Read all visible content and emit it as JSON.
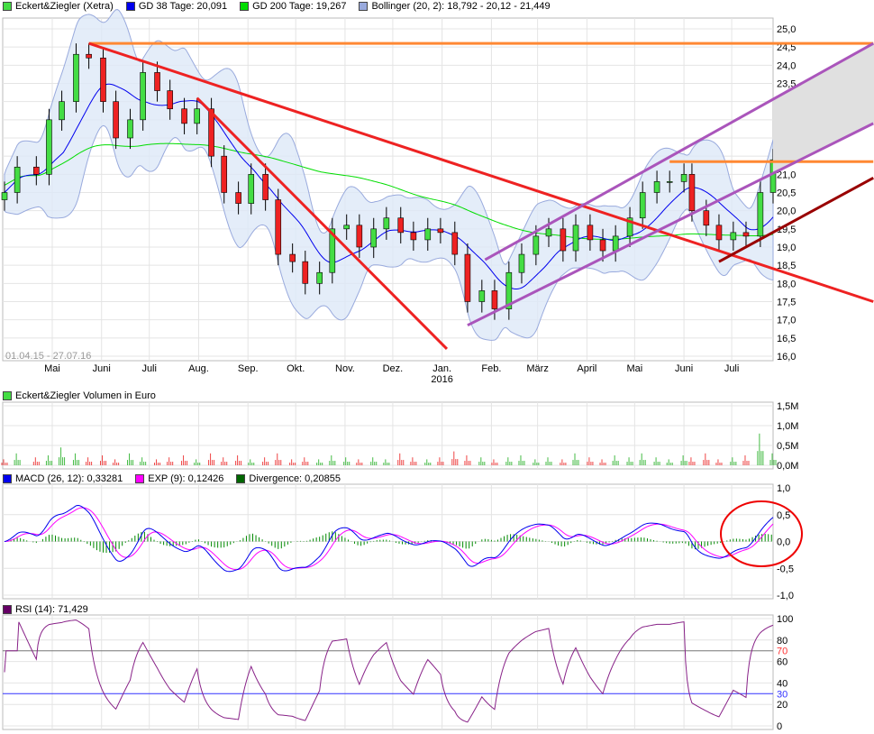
{
  "legends": {
    "price": [
      {
        "label": "Eckert&Ziegler (Xetra)",
        "color": "#44dd44"
      },
      {
        "label": "GD 38 Tage: 20,091",
        "color": "#0000ee"
      },
      {
        "label": "GD 200 Tage: 19,267",
        "color": "#00dd00"
      },
      {
        "label": "Bollinger (20, 2): 18,792 - 20,12 - 21,449",
        "color": "#99aadd"
      }
    ],
    "volume": [
      {
        "label": "Eckert&Ziegler Volumen in Euro",
        "color": "#44dd44"
      }
    ],
    "macd": [
      {
        "label": "MACD (26, 12): 0,33281",
        "color": "#0000ee"
      },
      {
        "label": "EXP (9): 0,12426",
        "color": "#ff00ff"
      },
      {
        "label": "Divergence: 0,20855",
        "color": "#006600"
      }
    ],
    "rsi": [
      {
        "label": "RSI (14): 71,429",
        "color": "#660066"
      }
    ]
  },
  "date_range": "01.04.15 - 27.07.16",
  "chart_data": [
    {
      "type": "candlestick",
      "panel": "price",
      "ylim": [
        16.0,
        25.0
      ],
      "yticks": [
        "16,0",
        "16,5",
        "17,0",
        "17,5",
        "18,0",
        "18,5",
        "19,0",
        "19,5",
        "20,0",
        "20,5",
        "21,0",
        "21,5",
        "22,0",
        "22,5",
        "23,0",
        "23,5",
        "24,0",
        "24,5",
        "25,0"
      ],
      "xticks": [
        {
          "label": "Mai",
          "date": "2015-05-01"
        },
        {
          "label": "Juni",
          "date": "2015-06-01"
        },
        {
          "label": "Juli",
          "date": "2015-07-01"
        },
        {
          "label": "Aug.",
          "date": "2015-08-01"
        },
        {
          "label": "Sep.",
          "date": "2015-09-01"
        },
        {
          "label": "Okt.",
          "date": "2015-10-01"
        },
        {
          "label": "Nov.",
          "date": "2015-11-01"
        },
        {
          "label": "Dez.",
          "date": "2015-12-01"
        },
        {
          "label": "Jan.",
          "date": "2016-01-01",
          "sub": "2016"
        },
        {
          "label": "Feb.",
          "date": "2016-02-01"
        },
        {
          "label": "März",
          "date": "2016-03-01"
        },
        {
          "label": "April",
          "date": "2016-04-01"
        },
        {
          "label": "Mai",
          "date": "2016-05-01"
        },
        {
          "label": "Juni",
          "date": "2016-06-01"
        },
        {
          "label": "Juli",
          "date": "2016-07-01"
        }
      ],
      "dates": [
        "2015-04-01",
        "2015-04-09",
        "2015-04-21",
        "2015-04-29",
        "2015-05-07",
        "2015-05-16",
        "2015-05-24",
        "2015-06-02",
        "2015-06-10",
        "2015-06-19",
        "2015-06-27",
        "2015-07-06",
        "2015-07-14",
        "2015-07-23",
        "2015-07-31",
        "2015-08-09",
        "2015-08-17",
        "2015-08-26",
        "2015-09-03",
        "2015-09-12",
        "2015-09-20",
        "2015-09-29",
        "2015-10-07",
        "2015-10-16",
        "2015-10-24",
        "2015-11-02",
        "2015-11-10",
        "2015-11-19",
        "2015-11-27",
        "2015-12-06",
        "2015-12-14",
        "2015-12-23",
        "2015-12-31",
        "2016-01-09",
        "2016-01-17",
        "2016-01-26",
        "2016-02-03",
        "2016-02-12",
        "2016-02-20",
        "2016-02-29",
        "2016-03-08",
        "2016-03-17",
        "2016-03-25",
        "2016-04-03",
        "2016-04-11",
        "2016-04-19",
        "2016-04-28",
        "2016-05-06",
        "2016-05-15",
        "2016-05-23",
        "2016-06-01",
        "2016-06-06",
        "2016-06-15",
        "2016-06-23",
        "2016-07-02",
        "2016-07-10",
        "2016-07-19",
        "2016-07-27"
      ],
      "close": [
        20.5,
        21.2,
        21.0,
        22.5,
        23.0,
        24.3,
        24.2,
        23.0,
        22.0,
        22.5,
        23.8,
        23.3,
        22.8,
        22.4,
        22.8,
        21.5,
        20.5,
        20.2,
        21.0,
        20.3,
        18.8,
        18.6,
        18.0,
        18.3,
        19.5,
        19.6,
        19.0,
        19.5,
        19.8,
        19.4,
        19.2,
        19.5,
        19.4,
        18.8,
        17.5,
        17.8,
        17.3,
        18.3,
        18.8,
        19.3,
        19.5,
        18.9,
        19.6,
        19.2,
        18.9,
        19.3,
        19.8,
        20.5,
        20.8,
        20.8,
        21.0,
        20.0,
        19.6,
        19.2,
        19.4,
        19.3,
        20.5,
        21.4
      ],
      "volume_M": [
        0.15,
        0.3,
        0.2,
        0.25,
        0.45,
        0.3,
        0.2,
        0.25,
        0.15,
        0.3,
        0.2,
        0.15,
        0.2,
        0.25,
        0.15,
        0.3,
        0.2,
        0.25,
        0.15,
        0.2,
        0.3,
        0.15,
        0.2,
        0.15,
        0.25,
        0.2,
        0.15,
        0.2,
        0.15,
        0.3,
        0.2,
        0.15,
        0.2,
        0.35,
        0.25,
        0.2,
        0.15,
        0.2,
        0.25,
        0.15,
        0.2,
        0.15,
        0.3,
        0.2,
        0.15,
        0.25,
        0.2,
        0.3,
        0.2,
        0.15,
        0.25,
        0.2,
        0.3,
        0.15,
        0.2,
        0.25,
        0.8,
        0.3
      ],
      "annotations": [
        {
          "color": "#ff8833",
          "from": [
            "2015-05-24",
            24.6
          ],
          "to": [
            "2016-09-28",
            24.6
          ]
        },
        {
          "color": "#ff8833",
          "from": [
            "2016-05-23",
            21.35
          ],
          "to": [
            "2016-09-28",
            21.35
          ]
        },
        {
          "color": "#ee2222",
          "from": [
            "2015-05-24",
            24.6
          ],
          "to": [
            "2016-09-28",
            17.5
          ]
        },
        {
          "color": "#ee2222",
          "from": [
            "2015-07-31",
            23.1
          ],
          "to": [
            "2016-01-04",
            16.2
          ]
        },
        {
          "color": "#aa55bb",
          "from": [
            "2016-01-17",
            16.85
          ],
          "to": [
            "2016-09-28",
            22.4
          ]
        },
        {
          "color": "#aa55bb",
          "from": [
            "2016-01-28",
            18.65
          ],
          "to": [
            "2016-09-28",
            24.6
          ]
        },
        {
          "color": "#990000",
          "from": [
            "2016-06-23",
            18.6
          ],
          "to": [
            "2016-09-28",
            20.9
          ]
        }
      ]
    },
    {
      "type": "bar",
      "panel": "volume",
      "ylim": [
        0,
        1.5
      ],
      "yticks": [
        "0,0M",
        "0,5M",
        "1,0M",
        "1,5M"
      ]
    },
    {
      "type": "line",
      "panel": "macd",
      "ylim": [
        -1.0,
        1.0
      ],
      "yticks": [
        "-1,0",
        "-0,5",
        "0,0",
        "0,5",
        "1,0"
      ]
    },
    {
      "type": "line",
      "panel": "rsi",
      "ylim": [
        0,
        100
      ],
      "yticks": [
        "0",
        "20",
        "40",
        "60",
        "80",
        "100"
      ],
      "levels": [
        {
          "value": 70,
          "label": "70",
          "color": "#ff3333"
        },
        {
          "value": 30,
          "label": "30",
          "color": "#3333ff"
        }
      ]
    }
  ]
}
